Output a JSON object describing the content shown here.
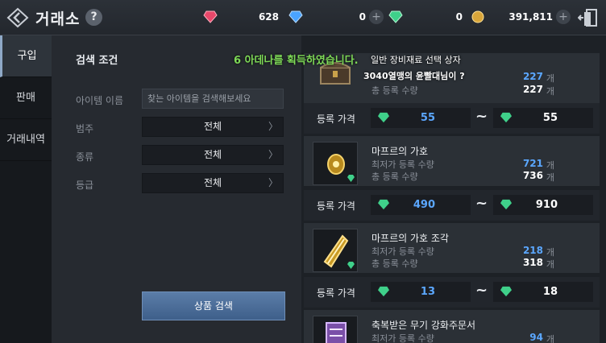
{
  "header": {
    "title": "거래소",
    "help_label": "?",
    "currencies": [
      {
        "name": "red-gem",
        "value": "628",
        "color": "#e8486a"
      },
      {
        "name": "blue-gem",
        "value": "0",
        "color": "#4aa3ff"
      },
      {
        "name": "green-gem",
        "value": "0",
        "color": "#3fd08a"
      },
      {
        "name": "adena",
        "value": "391,811",
        "color": "#d8a53a"
      }
    ],
    "plus_label": "+"
  },
  "tabs": [
    {
      "label": "구입",
      "active": true
    },
    {
      "label": "판매",
      "active": false
    },
    {
      "label": "거래내역",
      "active": false
    }
  ],
  "search": {
    "title": "검색 조건",
    "item_name_label": "아이템 이름",
    "item_name_placeholder": "찾는 아이템을 검색해보세요",
    "category_label": "범주",
    "category_value": "전체",
    "type_label": "종류",
    "type_value": "전체",
    "grade_label": "등급",
    "grade_value": "전체",
    "button_label": "상품 검색",
    "chevron": "〉"
  },
  "items": [
    {
      "name": "",
      "lowest_label": "",
      "total_label": "총 등록 수량",
      "lowest_value": "227",
      "total_value": "227",
      "unit": "개",
      "price_label": "등록 가격",
      "price_low": "55",
      "price_high": "55"
    },
    {
      "name": "마프르의 가호",
      "lowest_label": "최저가 등록 수량",
      "total_label": "총 등록 수량",
      "lowest_value": "721",
      "total_value": "736",
      "unit": "개",
      "price_label": "등록 가격",
      "price_low": "490",
      "price_high": "910"
    },
    {
      "name": "마프르의 가호 조각",
      "lowest_label": "최저가 등록 수량",
      "total_label": "총 등록 수량",
      "lowest_value": "218",
      "total_value": "318",
      "unit": "개",
      "price_label": "등록 가격",
      "price_low": "13",
      "price_high": "18"
    },
    {
      "name": "축복받은 무기 강화주문서",
      "lowest_label": "최저가 등록 수량",
      "lowest_value": "94",
      "unit": "개"
    }
  ],
  "tilde": "~",
  "notification": {
    "message": "6 아데나를 획득하였습니다.",
    "item": "일반 장비재료 선택 상자",
    "sub": "3040열맹의 윤빨대님이 ?"
  }
}
